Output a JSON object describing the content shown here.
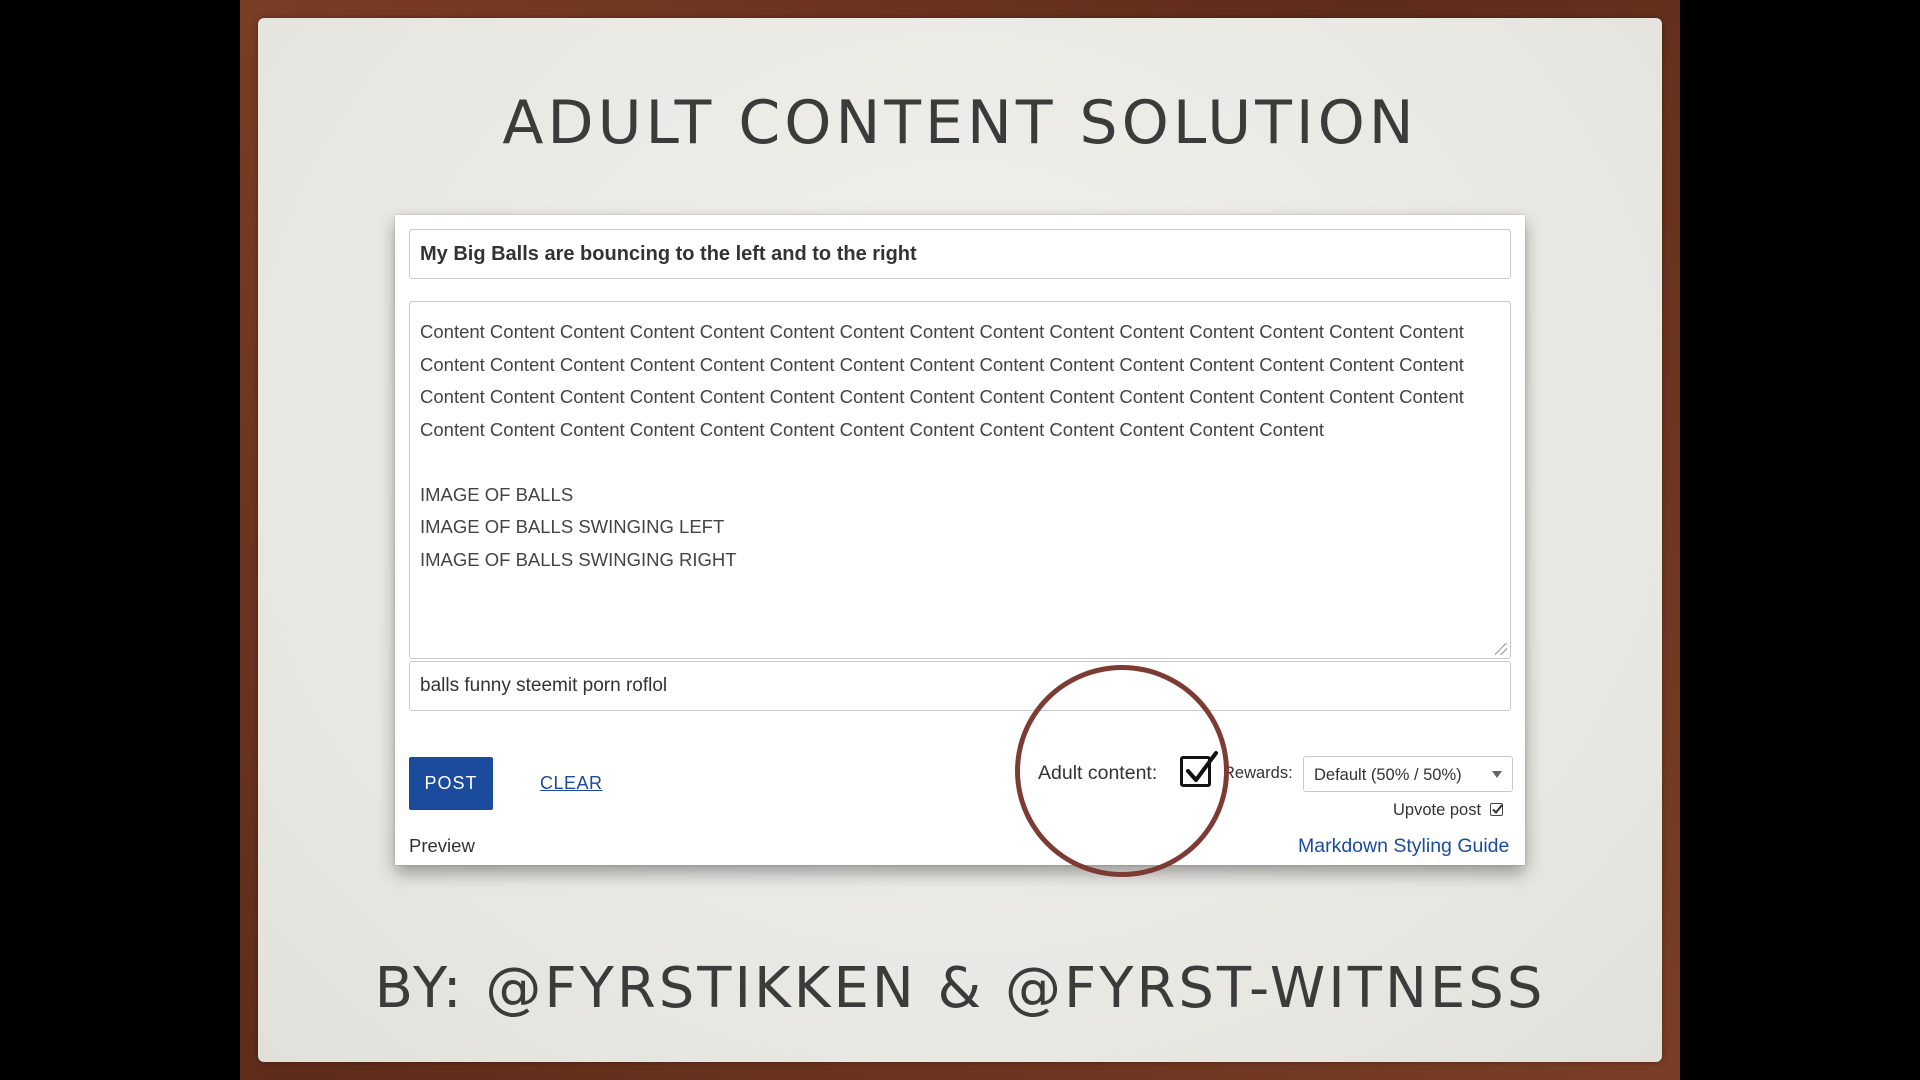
{
  "slide": {
    "title": "ADULT CONTENT SOLUTION",
    "byline": "BY: @FYRSTIKKEN & @FYRST-WITNESS"
  },
  "editor": {
    "title_value": "My Big Balls are bouncing to the left and to the right",
    "body_paragraph": "Content Content Content Content Content Content Content Content Content Content Content Content Content Content Content Content Content Content Content Content Content Content Content Content Content Content Content Content Content Content Content Content Content Content Content Content Content Content Content Content Content Content Content Content Content Content Content Content Content Content Content Content Content Content Content Content Content Content",
    "body_lines": [
      "IMAGE OF BALLS",
      "IMAGE OF BALLS SWINGING LEFT",
      "IMAGE OF BALLS SWINGING RIGHT"
    ],
    "tags_value": "balls funny steemit porn roflol",
    "post_label": "POST",
    "clear_label": "CLEAR",
    "preview_label": "Preview",
    "adult_label": "Adult content:",
    "adult_checked": true,
    "rewards_label": "Rewards:",
    "rewards_value": "Default (50% / 50%)",
    "upvote_label": "Upvote post",
    "upvote_checked": true,
    "markdown_label": "Markdown Styling Guide"
  },
  "colors": {
    "accent": "#1a4b9c",
    "frame": "#6f3621",
    "circle": "#7c3b33"
  }
}
